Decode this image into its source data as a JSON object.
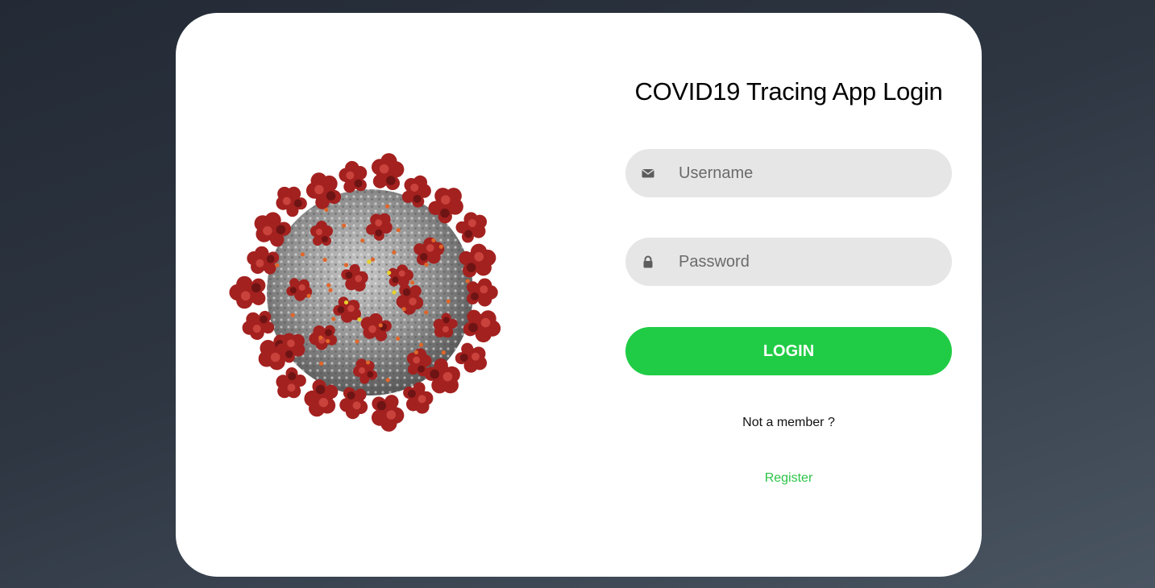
{
  "login": {
    "title": "COVID19 Tracing App Login",
    "username_placeholder": "Username",
    "password_placeholder": "Password",
    "username_icon": "envelope-icon",
    "password_icon": "lock-icon",
    "login_label": "LOGIN",
    "not_member_text": "Not a member ?",
    "register_label": "Register"
  },
  "colors": {
    "accent": "#20cc45",
    "register_link": "#2bc447",
    "input_bg": "#e6e6e6",
    "card_bg": "#ffffff"
  }
}
